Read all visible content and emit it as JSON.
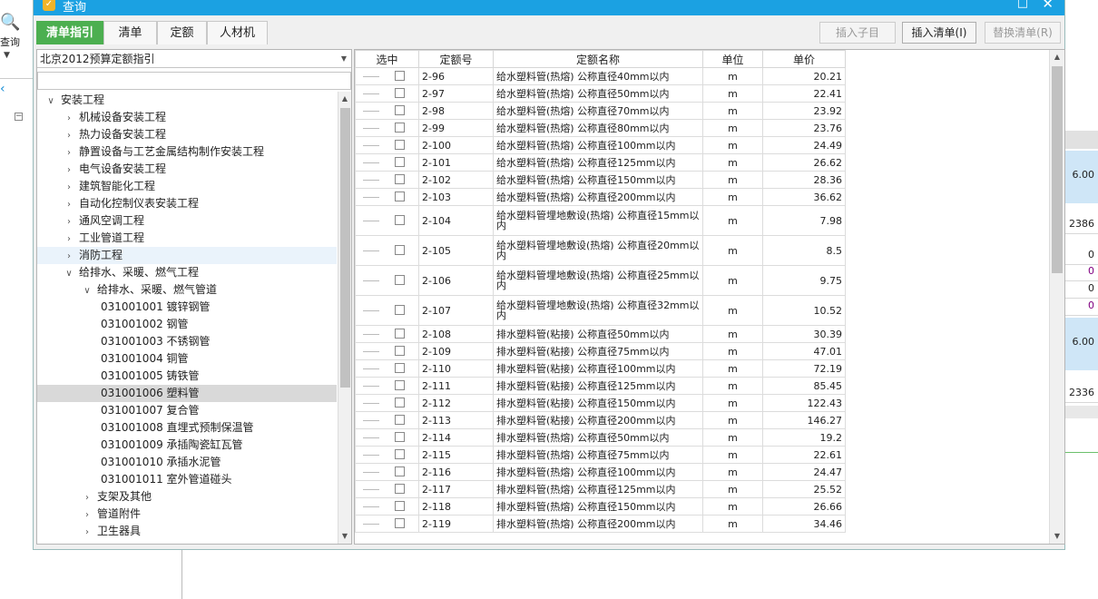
{
  "window": {
    "title": "查询",
    "maximize_glyph": "□",
    "close_glyph": "✕"
  },
  "background": {
    "query_label": "查询",
    "right_values": [
      "6.00",
      "2386",
      "0",
      "0",
      "0",
      "0",
      "6.00",
      "2336"
    ]
  },
  "tabs": [
    {
      "label": "清单指引",
      "active": true
    },
    {
      "label": "清单",
      "active": false
    },
    {
      "label": "定额",
      "active": false
    },
    {
      "label": "人材机",
      "active": false
    }
  ],
  "buttons": {
    "insert_child": "插入子目",
    "insert_list": "插入清单(I)",
    "replace_list": "替换清单(R)"
  },
  "combo": {
    "value": "北京2012预算定额指引"
  },
  "search": {
    "placeholder": ""
  },
  "tree": [
    {
      "label": "安装工程",
      "level": 0,
      "toggle": "expanded"
    },
    {
      "label": "机械设备安装工程",
      "level": 1,
      "toggle": "collapsed"
    },
    {
      "label": "热力设备安装工程",
      "level": 1,
      "toggle": "collapsed"
    },
    {
      "label": "静置设备与工艺金属结构制作安装工程",
      "level": 1,
      "toggle": "collapsed"
    },
    {
      "label": "电气设备安装工程",
      "level": 1,
      "toggle": "collapsed"
    },
    {
      "label": "建筑智能化工程",
      "level": 1,
      "toggle": "collapsed"
    },
    {
      "label": "自动化控制仪表安装工程",
      "level": 1,
      "toggle": "collapsed"
    },
    {
      "label": "通风空调工程",
      "level": 1,
      "toggle": "collapsed"
    },
    {
      "label": "工业管道工程",
      "level": 1,
      "toggle": "collapsed"
    },
    {
      "label": "消防工程",
      "level": 1,
      "toggle": "collapsed",
      "hover": true
    },
    {
      "label": "给排水、采暖、燃气工程",
      "level": 1,
      "toggle": "expanded"
    },
    {
      "label": "给排水、采暖、燃气管道",
      "level": 2,
      "toggle": "expanded"
    },
    {
      "label": "031001001  镀锌钢管",
      "level": 3,
      "toggle": "none"
    },
    {
      "label": "031001002  钢管",
      "level": 3,
      "toggle": "none"
    },
    {
      "label": "031001003  不锈钢管",
      "level": 3,
      "toggle": "none"
    },
    {
      "label": "031001004  铜管",
      "level": 3,
      "toggle": "none"
    },
    {
      "label": "031001005  铸铁管",
      "level": 3,
      "toggle": "none"
    },
    {
      "label": "031001006  塑料管",
      "level": 3,
      "toggle": "none",
      "selected": true
    },
    {
      "label": "031001007  复合管",
      "level": 3,
      "toggle": "none"
    },
    {
      "label": "031001008  直埋式预制保温管",
      "level": 3,
      "toggle": "none"
    },
    {
      "label": "031001009  承插陶瓷缸瓦管",
      "level": 3,
      "toggle": "none"
    },
    {
      "label": "031001010  承插水泥管",
      "level": 3,
      "toggle": "none"
    },
    {
      "label": "031001011  室外管道碰头",
      "level": 3,
      "toggle": "none"
    },
    {
      "label": "支架及其他",
      "level": 2,
      "toggle": "collapsed"
    },
    {
      "label": "管道附件",
      "level": 2,
      "toggle": "collapsed"
    },
    {
      "label": "卫生器具",
      "level": 2,
      "toggle": "collapsed"
    }
  ],
  "table": {
    "headers": {
      "check": "选中",
      "code": "定额号",
      "name": "定额名称",
      "unit": "单位",
      "price": "单价"
    },
    "rows": [
      {
        "code": "2-96",
        "name": "给水塑料管(热熔) 公称直径40mm以内",
        "unit": "m",
        "price": "20.21"
      },
      {
        "code": "2-97",
        "name": "给水塑料管(热熔) 公称直径50mm以内",
        "unit": "m",
        "price": "22.41"
      },
      {
        "code": "2-98",
        "name": "给水塑料管(热熔) 公称直径70mm以内",
        "unit": "m",
        "price": "23.92"
      },
      {
        "code": "2-99",
        "name": "给水塑料管(热熔) 公称直径80mm以内",
        "unit": "m",
        "price": "23.76"
      },
      {
        "code": "2-100",
        "name": "给水塑料管(热熔) 公称直径100mm以内",
        "unit": "m",
        "price": "24.49"
      },
      {
        "code": "2-101",
        "name": "给水塑料管(热熔) 公称直径125mm以内",
        "unit": "m",
        "price": "26.62"
      },
      {
        "code": "2-102",
        "name": "给水塑料管(热熔) 公称直径150mm以内",
        "unit": "m",
        "price": "28.36"
      },
      {
        "code": "2-103",
        "name": "给水塑料管(热熔) 公称直径200mm以内",
        "unit": "m",
        "price": "36.62"
      },
      {
        "code": "2-104",
        "name": "给水塑料管埋地敷设(热熔) 公称直径15mm以内",
        "unit": "m",
        "price": "7.98"
      },
      {
        "code": "2-105",
        "name": "给水塑料管埋地敷设(热熔) 公称直径20mm以内",
        "unit": "m",
        "price": "8.5"
      },
      {
        "code": "2-106",
        "name": "给水塑料管埋地敷设(热熔) 公称直径25mm以内",
        "unit": "m",
        "price": "9.75"
      },
      {
        "code": "2-107",
        "name": "给水塑料管埋地敷设(热熔) 公称直径32mm以内",
        "unit": "m",
        "price": "10.52"
      },
      {
        "code": "2-108",
        "name": "排水塑料管(粘接) 公称直径50mm以内",
        "unit": "m",
        "price": "30.39"
      },
      {
        "code": "2-109",
        "name": "排水塑料管(粘接) 公称直径75mm以内",
        "unit": "m",
        "price": "47.01"
      },
      {
        "code": "2-110",
        "name": "排水塑料管(粘接) 公称直径100mm以内",
        "unit": "m",
        "price": "72.19"
      },
      {
        "code": "2-111",
        "name": "排水塑料管(粘接) 公称直径125mm以内",
        "unit": "m",
        "price": "85.45"
      },
      {
        "code": "2-112",
        "name": "排水塑料管(粘接) 公称直径150mm以内",
        "unit": "m",
        "price": "122.43"
      },
      {
        "code": "2-113",
        "name": "排水塑料管(粘接) 公称直径200mm以内",
        "unit": "m",
        "price": "146.27"
      },
      {
        "code": "2-114",
        "name": "排水塑料管(热熔) 公称直径50mm以内",
        "unit": "m",
        "price": "19.2"
      },
      {
        "code": "2-115",
        "name": "排水塑料管(热熔) 公称直径75mm以内",
        "unit": "m",
        "price": "22.61"
      },
      {
        "code": "2-116",
        "name": "排水塑料管(热熔) 公称直径100mm以内",
        "unit": "m",
        "price": "24.47"
      },
      {
        "code": "2-117",
        "name": "排水塑料管(热熔) 公称直径125mm以内",
        "unit": "m",
        "price": "25.52"
      },
      {
        "code": "2-118",
        "name": "排水塑料管(热熔) 公称直径150mm以内",
        "unit": "m",
        "price": "26.66"
      },
      {
        "code": "2-119",
        "name": "排水塑料管(热熔) 公称直径200mm以内",
        "unit": "m",
        "price": "34.46"
      }
    ]
  },
  "colors": {
    "title_bar": "#1ba1e2",
    "active_tab": "#4caf50",
    "selected_row": "#d9d9d9"
  }
}
